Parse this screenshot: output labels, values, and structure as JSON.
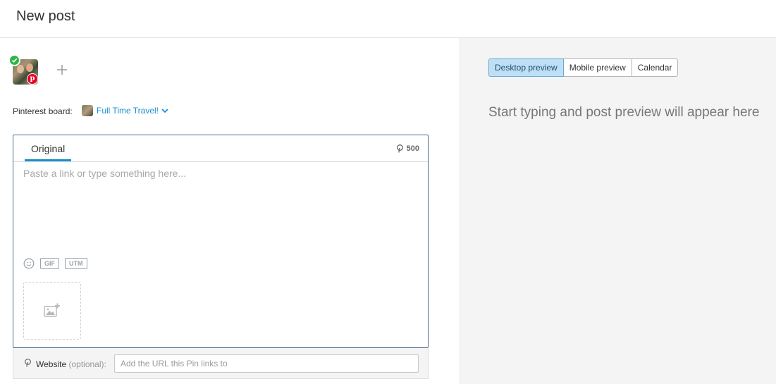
{
  "header": {
    "title": "New post"
  },
  "composer": {
    "board_label": "Pinterest board:",
    "board_name": "Full Time Travel!",
    "tab_label": "Original",
    "char_count": "500",
    "post_placeholder": "Paste a link or type something here...",
    "gif_label": "GIF",
    "utm_label": "UTM",
    "website_label": "Website",
    "website_optional": "(optional):",
    "website_placeholder": "Add the URL this Pin links to"
  },
  "preview": {
    "tabs": [
      {
        "label": "Desktop preview",
        "active": true
      },
      {
        "label": "Mobile preview",
        "active": false
      },
      {
        "label": "Calendar",
        "active": false
      }
    ],
    "empty_text": "Start typing and post preview will appear here"
  },
  "colors": {
    "accent": "#1a8fd1",
    "pinterest": "#e60023",
    "success": "#2ab64a",
    "active_tab_bg": "#bfe0f4"
  },
  "icons": [
    "check-icon",
    "pinterest-icon",
    "plus-icon",
    "chevron-down-icon",
    "emoji-icon",
    "add-image-icon"
  ]
}
